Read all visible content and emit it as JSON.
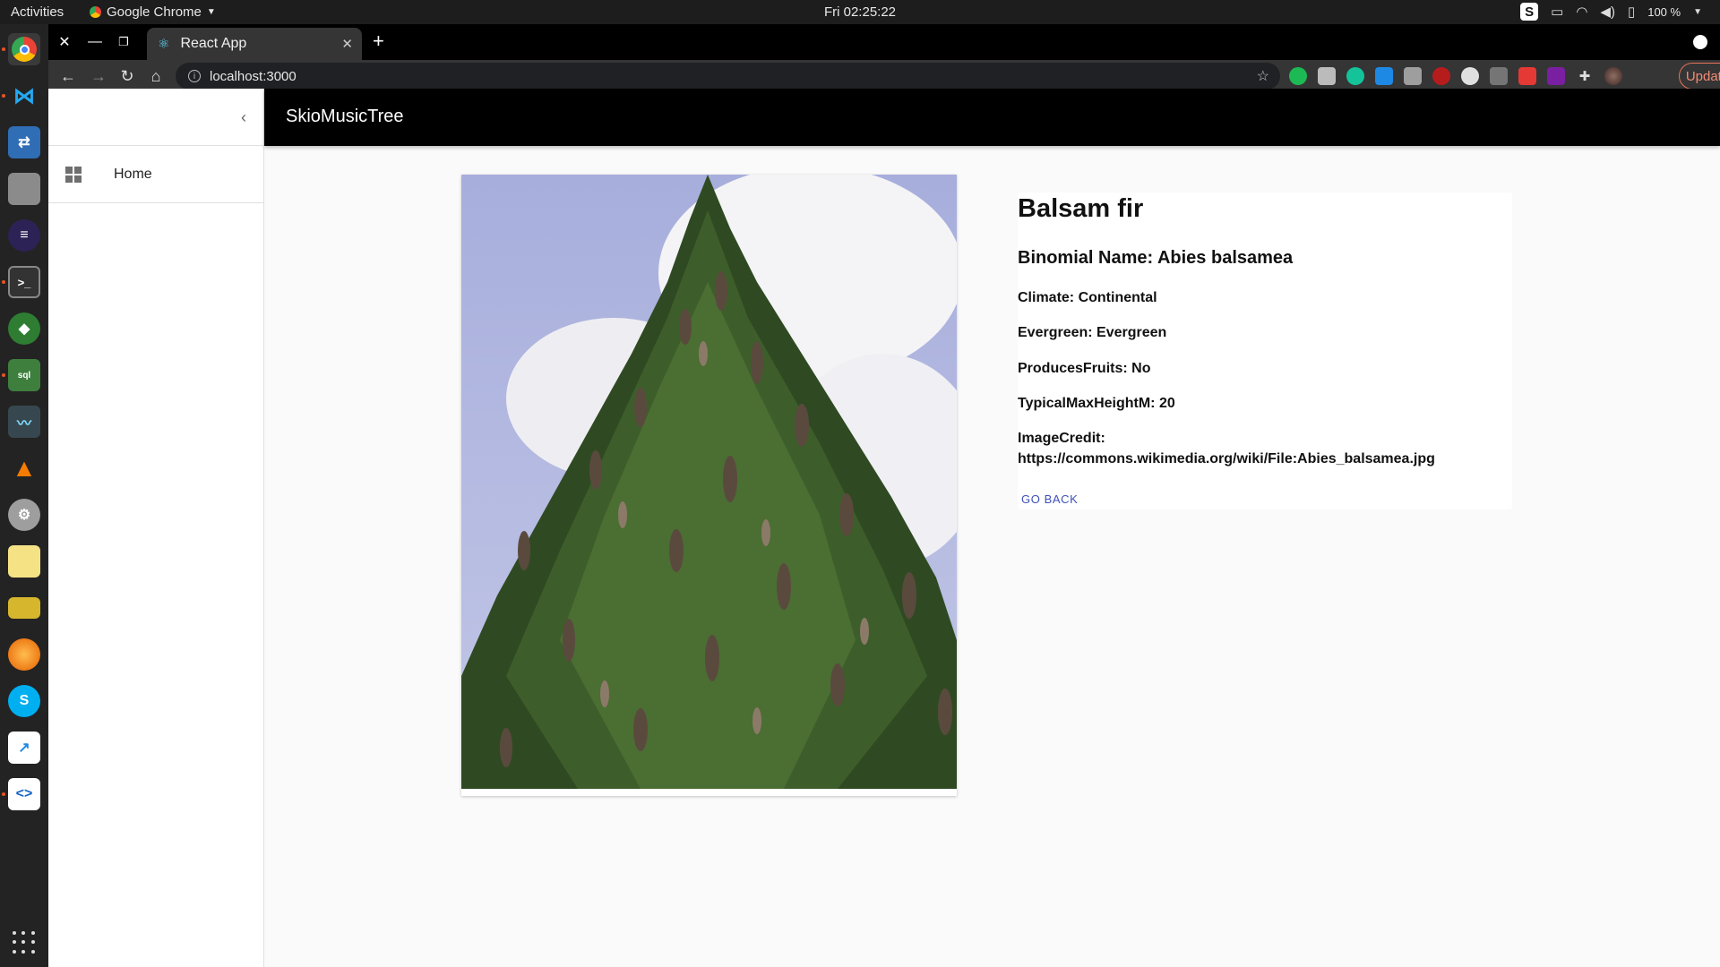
{
  "os": {
    "activities": "Activities",
    "app_name": "Google Chrome",
    "clock": "Fri 02:25:22",
    "battery": "100 %"
  },
  "browser": {
    "tab_title": "React App",
    "url": "localhost:3000",
    "update_label": "Update"
  },
  "app": {
    "brand": "SkioMusicTree",
    "nav_home": "Home"
  },
  "tree": {
    "name": "Balsam fir",
    "binomial": "Binomial Name: Abies balsamea",
    "climate": "Climate: Continental",
    "evergreen": "Evergreen: Evergreen",
    "fruits": "ProducesFruits: No",
    "height": "TypicalMaxHeightM: 20",
    "credit_label": "ImageCredit:",
    "credit_url": "https://commons.wikimedia.org/wiki/File:Abies_balsamea.jpg",
    "go_back": "GO BACK"
  },
  "colors": {
    "appbar": "#000000",
    "link": "#3f51b5",
    "update": "#f28b74"
  },
  "dock_icons": [
    "chrome-icon",
    "vscode-icon",
    "network-icon",
    "files-icon",
    "eclipse-icon",
    "terminal-icon",
    "robo3t-icon",
    "sqlite-icon",
    "system-monitor-icon",
    "vlc-icon",
    "settings-icon",
    "notes-icon",
    "ruler-icon",
    "firefox-icon",
    "skype-icon",
    "stats-icon",
    "code-editor-icon"
  ]
}
